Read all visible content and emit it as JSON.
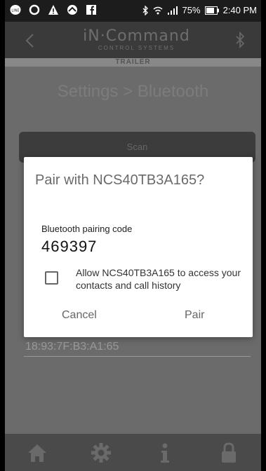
{
  "status_bar": {
    "notification_icons": [
      "line-icon",
      "alert-icon",
      "warning-icon",
      "cloud-icon",
      "facebook-icon"
    ],
    "battery": "75%",
    "time": "2:40 PM"
  },
  "header": {
    "brand_name": "iN·Command",
    "brand_sub": "CONTROL SYSTEMS",
    "mode": "TRAILER"
  },
  "page": {
    "title": "Settings > Bluetooth",
    "scan_label": "Scan",
    "device_mac": "18:93:7F:B3:A1:65"
  },
  "dialog": {
    "title": "Pair with NCS40TB3A165?",
    "code_label": "Bluetooth pairing code",
    "code": "469397",
    "checkbox_text": "Allow NCS40TB3A165 to access your contacts and call history",
    "cancel": "Cancel",
    "pair": "Pair"
  },
  "nav": {
    "icons": [
      "home-icon",
      "gear-icon",
      "info-icon",
      "lock-icon"
    ]
  }
}
